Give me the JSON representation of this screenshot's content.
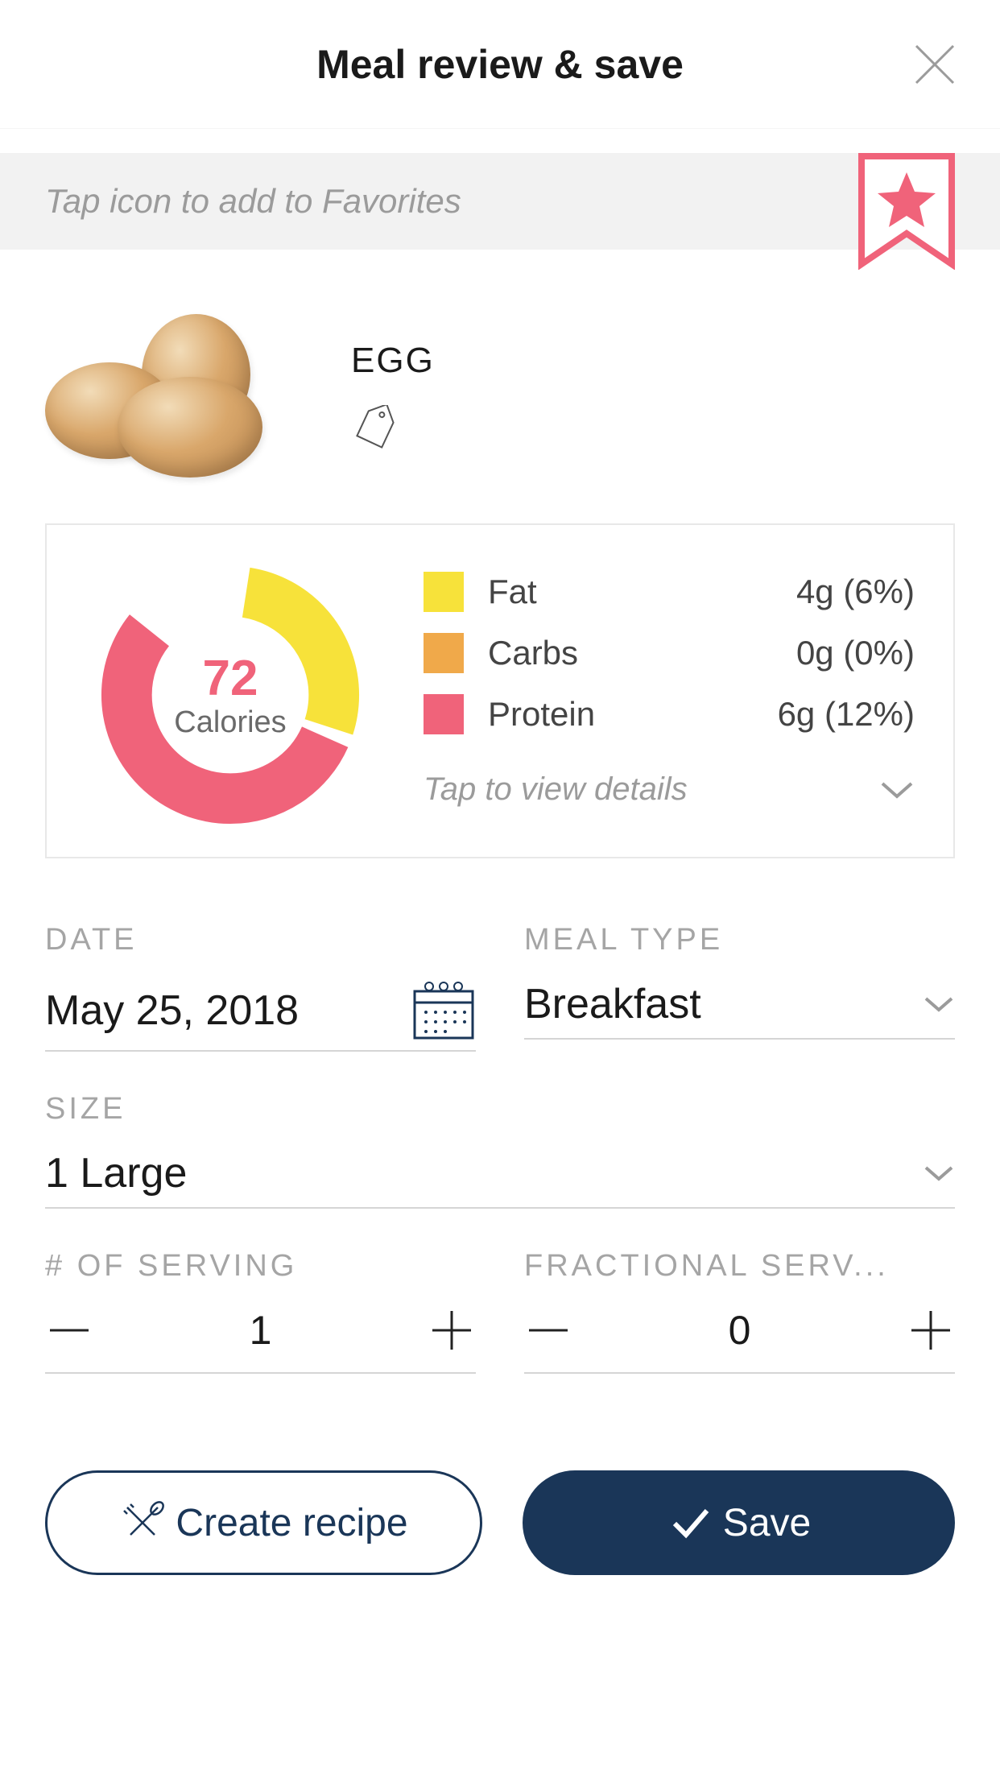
{
  "header": {
    "title": "Meal review & save"
  },
  "favorites": {
    "hint": "Tap icon to add to Favorites"
  },
  "food": {
    "name": "EGG"
  },
  "nutrition": {
    "calories_value": "72",
    "calories_label": "Calories",
    "details_hint": "Tap to view details",
    "macros": [
      {
        "name": "Fat",
        "value": "4g (6%)",
        "color": "#f7e23a"
      },
      {
        "name": "Carbs",
        "value": "0g (0%)",
        "color": "#f0a94a"
      },
      {
        "name": "Protein",
        "value": "6g (12%)",
        "color": "#f0637a"
      }
    ]
  },
  "form": {
    "date_label": "DATE",
    "date_value": "May 25, 2018",
    "meal_type_label": "MEAL TYPE",
    "meal_type_value": "Breakfast",
    "size_label": "SIZE",
    "size_value": "1 Large",
    "servings_label": "# OF SERVING",
    "servings_value": "1",
    "fractional_label": "FRACTIONAL SERV...",
    "fractional_value": "0"
  },
  "actions": {
    "create_recipe": "Create recipe",
    "save": "Save"
  },
  "chart_data": {
    "type": "pie",
    "title": "Macronutrient calorie breakdown",
    "series": [
      {
        "name": "Fat",
        "value": 36,
        "color": "#f7e23a"
      },
      {
        "name": "Carbs",
        "value": 0,
        "color": "#f0a94a"
      },
      {
        "name": "Protein",
        "value": 24,
        "color": "#f0637a"
      }
    ],
    "center_value": 72,
    "center_label": "Calories"
  }
}
